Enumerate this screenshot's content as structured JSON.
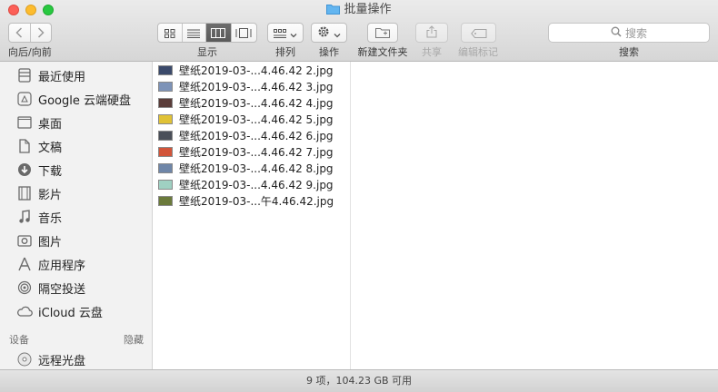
{
  "window": {
    "title": "批量操作"
  },
  "toolbar": {
    "nav_label": "向后/向前",
    "view_label": "显示",
    "arrange_label": "排列",
    "action_label": "操作",
    "new_folder_label": "新建文件夹",
    "share_label": "共享",
    "edit_tags_label": "编辑标记",
    "search_label": "搜索",
    "search_placeholder": "搜索"
  },
  "sidebar": {
    "favorites": [
      {
        "label": "最近使用",
        "icon": "recents-icon"
      },
      {
        "label": "Google 云端硬盘",
        "icon": "google-drive-icon"
      },
      {
        "label": "桌面",
        "icon": "desktop-icon"
      },
      {
        "label": "文稿",
        "icon": "documents-icon"
      },
      {
        "label": "下载",
        "icon": "downloads-icon"
      },
      {
        "label": "影片",
        "icon": "movies-icon"
      },
      {
        "label": "音乐",
        "icon": "music-icon"
      },
      {
        "label": "图片",
        "icon": "pictures-icon"
      },
      {
        "label": "应用程序",
        "icon": "applications-icon"
      },
      {
        "label": "隔空投送",
        "icon": "airdrop-icon"
      },
      {
        "label": "iCloud 云盘",
        "icon": "icloud-icon"
      }
    ],
    "devices_header": "设备",
    "devices_hide": "隐藏",
    "devices": [
      {
        "label": "远程光盘",
        "icon": "remote-disc-icon"
      }
    ]
  },
  "files": [
    {
      "name": "壁纸2019-03-...4.46.42 2.jpg",
      "thumb_color": "#3b4a6b"
    },
    {
      "name": "壁纸2019-03-...4.46.42 3.jpg",
      "thumb_color": "#7d93b8"
    },
    {
      "name": "壁纸2019-03-...4.46.42 4.jpg",
      "thumb_color": "#5a3d3a"
    },
    {
      "name": "壁纸2019-03-...4.46.42 5.jpg",
      "thumb_color": "#e0c236"
    },
    {
      "name": "壁纸2019-03-...4.46.42 6.jpg",
      "thumb_color": "#4a4f59"
    },
    {
      "name": "壁纸2019-03-...4.46.42 7.jpg",
      "thumb_color": "#d2553a"
    },
    {
      "name": "壁纸2019-03-...4.46.42 8.jpg",
      "thumb_color": "#6f86a8"
    },
    {
      "name": "壁纸2019-03-...4.46.42 9.jpg",
      "thumb_color": "#9fd0c2"
    },
    {
      "name": "壁纸2019-03-...午4.46.42.jpg",
      "thumb_color": "#6b7a3b"
    }
  ],
  "status": {
    "text": "9 项，104.23 GB 可用"
  }
}
